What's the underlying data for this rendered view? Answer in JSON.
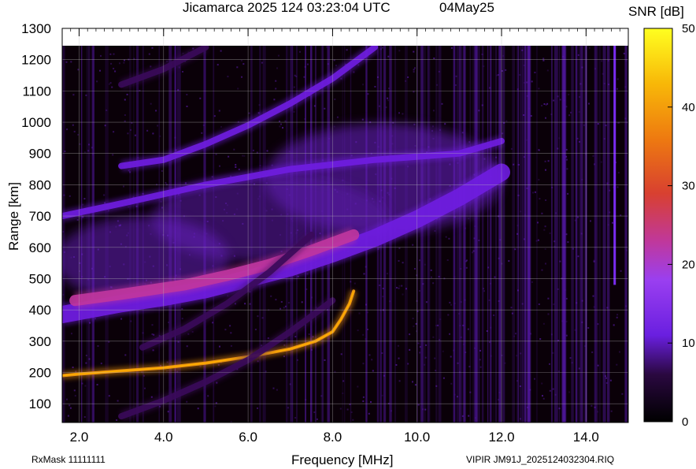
{
  "header": {
    "title": "Jicamarca 2025 124 03:23:04 UTC",
    "date": "04May25"
  },
  "footer": {
    "rxmask": "RxMask 11111111",
    "file": "VIPIR  JM91J_2025124032304.RIQ"
  },
  "colorbar": {
    "label": "SNR [dB]",
    "ticks": [
      "50",
      "40",
      "30",
      "20",
      "10",
      "0"
    ],
    "range": [
      0,
      50
    ]
  },
  "colors": {
    "background": "#0a0008",
    "colormap": [
      "#000000",
      "#3a0a5a",
      "#6f1de0",
      "#9a3ff0",
      "#c0369e",
      "#e35a2a",
      "#f79a10",
      "#ffe000",
      "#ffff20"
    ]
  },
  "chart_data": {
    "type": "heatmap",
    "xlabel": "Frequency [MHz]",
    "ylabel": "Range [km]",
    "xlim": [
      1.6,
      15.0
    ],
    "ylim": [
      40,
      1300
    ],
    "xticks": [
      2.0,
      4.0,
      6.0,
      8.0,
      10.0,
      12.0,
      14.0
    ],
    "xtick_labels": [
      "2.0",
      "4.0",
      "6.0",
      "8.0",
      "10.0",
      "12.0",
      "14.0"
    ],
    "yticks": [
      100,
      200,
      300,
      400,
      500,
      600,
      700,
      800,
      900,
      1000,
      1100,
      1200,
      1300
    ],
    "ytick_labels": [
      "100",
      "200",
      "300",
      "400",
      "500",
      "600",
      "700",
      "800",
      "900",
      "1000",
      "1100",
      "1200",
      "1300"
    ],
    "grid": true,
    "traces": [
      {
        "name": "E/F1 low trace",
        "snr": 38,
        "points": [
          [
            1.6,
            190
          ],
          [
            2.0,
            195
          ],
          [
            3.0,
            205
          ],
          [
            4.0,
            215
          ],
          [
            5.0,
            230
          ],
          [
            6.0,
            250
          ],
          [
            7.0,
            275
          ],
          [
            7.6,
            300
          ],
          [
            8.0,
            330
          ],
          [
            8.2,
            370
          ],
          [
            8.4,
            420
          ],
          [
            8.5,
            460
          ]
        ]
      },
      {
        "name": "F2 trace",
        "snr": 14,
        "points": [
          [
            1.6,
            385
          ],
          [
            2.0,
            395
          ],
          [
            3.0,
            420
          ],
          [
            4.0,
            440
          ],
          [
            5.0,
            465
          ],
          [
            6.0,
            500
          ],
          [
            7.0,
            535
          ],
          [
            8.0,
            580
          ],
          [
            9.0,
            630
          ],
          [
            10.0,
            690
          ],
          [
            11.0,
            760
          ],
          [
            12.0,
            840
          ]
        ]
      },
      {
        "name": "F2 strong band",
        "snr": 26,
        "points": [
          [
            1.9,
            430
          ],
          [
            3.0,
            450
          ],
          [
            4.5,
            480
          ],
          [
            5.5,
            510
          ],
          [
            6.5,
            545
          ],
          [
            7.5,
            590
          ],
          [
            8.5,
            640
          ]
        ]
      },
      {
        "name": "multi-hop 2",
        "snr": 10,
        "points": [
          [
            1.6,
            700
          ],
          [
            3.0,
            740
          ],
          [
            5.0,
            800
          ],
          [
            7.0,
            850
          ],
          [
            9.0,
            880
          ],
          [
            11.0,
            900
          ],
          [
            12.0,
            940
          ]
        ]
      },
      {
        "name": "multi-hop 3",
        "snr": 11,
        "points": [
          [
            3.0,
            860
          ],
          [
            4.0,
            880
          ],
          [
            5.0,
            930
          ],
          [
            6.0,
            990
          ],
          [
            7.0,
            1060
          ],
          [
            8.0,
            1140
          ],
          [
            9.0,
            1240
          ]
        ]
      },
      {
        "name": "oblique faint",
        "snr": 8,
        "points": [
          [
            3.5,
            280
          ],
          [
            4.5,
            340
          ],
          [
            5.5,
            420
          ],
          [
            6.5,
            520
          ],
          [
            7.5,
            640
          ]
        ]
      },
      {
        "name": "oblique faint 2",
        "snr": 7,
        "points": [
          [
            3.0,
            60
          ],
          [
            4.0,
            110
          ],
          [
            5.0,
            170
          ],
          [
            6.0,
            240
          ],
          [
            7.0,
            330
          ],
          [
            8.0,
            430
          ]
        ]
      },
      {
        "name": "upper streak",
        "snr": 9,
        "points": [
          [
            3.0,
            1120
          ],
          [
            4.0,
            1170
          ],
          [
            5.0,
            1240
          ]
        ]
      }
    ]
  }
}
